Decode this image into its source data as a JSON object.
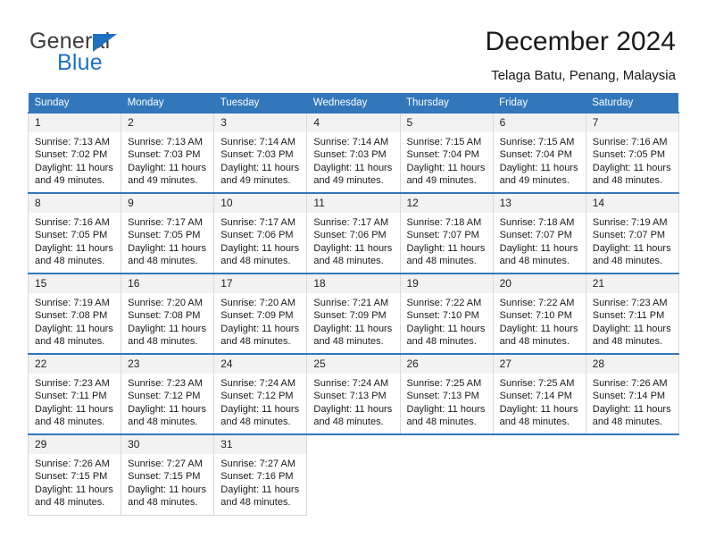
{
  "brand": {
    "name_top": "General",
    "name_bottom": "Blue",
    "accent_color": "#1f70c1"
  },
  "header": {
    "title": "December 2024",
    "subtitle": "Telaga Batu, Penang, Malaysia"
  },
  "theme": {
    "header_row_color": "#3377bb",
    "daynum_band_color": "#f2f2f2",
    "cell_border_color": "#d9d9d9"
  },
  "weekdays": [
    "Sunday",
    "Monday",
    "Tuesday",
    "Wednesday",
    "Thursday",
    "Friday",
    "Saturday"
  ],
  "labels": {
    "sunrise_prefix": "Sunrise: ",
    "sunset_prefix": "Sunset: ",
    "daylight_prefix": "Daylight: "
  },
  "weeks": [
    [
      {
        "day": "1",
        "sunrise": "Sunrise: 7:13 AM",
        "sunset": "Sunset: 7:02 PM",
        "daylight_line1": "Daylight: 11 hours",
        "daylight_line2": "and 49 minutes."
      },
      {
        "day": "2",
        "sunrise": "Sunrise: 7:13 AM",
        "sunset": "Sunset: 7:03 PM",
        "daylight_line1": "Daylight: 11 hours",
        "daylight_line2": "and 49 minutes."
      },
      {
        "day": "3",
        "sunrise": "Sunrise: 7:14 AM",
        "sunset": "Sunset: 7:03 PM",
        "daylight_line1": "Daylight: 11 hours",
        "daylight_line2": "and 49 minutes."
      },
      {
        "day": "4",
        "sunrise": "Sunrise: 7:14 AM",
        "sunset": "Sunset: 7:03 PM",
        "daylight_line1": "Daylight: 11 hours",
        "daylight_line2": "and 49 minutes."
      },
      {
        "day": "5",
        "sunrise": "Sunrise: 7:15 AM",
        "sunset": "Sunset: 7:04 PM",
        "daylight_line1": "Daylight: 11 hours",
        "daylight_line2": "and 49 minutes."
      },
      {
        "day": "6",
        "sunrise": "Sunrise: 7:15 AM",
        "sunset": "Sunset: 7:04 PM",
        "daylight_line1": "Daylight: 11 hours",
        "daylight_line2": "and 49 minutes."
      },
      {
        "day": "7",
        "sunrise": "Sunrise: 7:16 AM",
        "sunset": "Sunset: 7:05 PM",
        "daylight_line1": "Daylight: 11 hours",
        "daylight_line2": "and 48 minutes."
      }
    ],
    [
      {
        "day": "8",
        "sunrise": "Sunrise: 7:16 AM",
        "sunset": "Sunset: 7:05 PM",
        "daylight_line1": "Daylight: 11 hours",
        "daylight_line2": "and 48 minutes."
      },
      {
        "day": "9",
        "sunrise": "Sunrise: 7:17 AM",
        "sunset": "Sunset: 7:05 PM",
        "daylight_line1": "Daylight: 11 hours",
        "daylight_line2": "and 48 minutes."
      },
      {
        "day": "10",
        "sunrise": "Sunrise: 7:17 AM",
        "sunset": "Sunset: 7:06 PM",
        "daylight_line1": "Daylight: 11 hours",
        "daylight_line2": "and 48 minutes."
      },
      {
        "day": "11",
        "sunrise": "Sunrise: 7:17 AM",
        "sunset": "Sunset: 7:06 PM",
        "daylight_line1": "Daylight: 11 hours",
        "daylight_line2": "and 48 minutes."
      },
      {
        "day": "12",
        "sunrise": "Sunrise: 7:18 AM",
        "sunset": "Sunset: 7:07 PM",
        "daylight_line1": "Daylight: 11 hours",
        "daylight_line2": "and 48 minutes."
      },
      {
        "day": "13",
        "sunrise": "Sunrise: 7:18 AM",
        "sunset": "Sunset: 7:07 PM",
        "daylight_line1": "Daylight: 11 hours",
        "daylight_line2": "and 48 minutes."
      },
      {
        "day": "14",
        "sunrise": "Sunrise: 7:19 AM",
        "sunset": "Sunset: 7:07 PM",
        "daylight_line1": "Daylight: 11 hours",
        "daylight_line2": "and 48 minutes."
      }
    ],
    [
      {
        "day": "15",
        "sunrise": "Sunrise: 7:19 AM",
        "sunset": "Sunset: 7:08 PM",
        "daylight_line1": "Daylight: 11 hours",
        "daylight_line2": "and 48 minutes."
      },
      {
        "day": "16",
        "sunrise": "Sunrise: 7:20 AM",
        "sunset": "Sunset: 7:08 PM",
        "daylight_line1": "Daylight: 11 hours",
        "daylight_line2": "and 48 minutes."
      },
      {
        "day": "17",
        "sunrise": "Sunrise: 7:20 AM",
        "sunset": "Sunset: 7:09 PM",
        "daylight_line1": "Daylight: 11 hours",
        "daylight_line2": "and 48 minutes."
      },
      {
        "day": "18",
        "sunrise": "Sunrise: 7:21 AM",
        "sunset": "Sunset: 7:09 PM",
        "daylight_line1": "Daylight: 11 hours",
        "daylight_line2": "and 48 minutes."
      },
      {
        "day": "19",
        "sunrise": "Sunrise: 7:22 AM",
        "sunset": "Sunset: 7:10 PM",
        "daylight_line1": "Daylight: 11 hours",
        "daylight_line2": "and 48 minutes."
      },
      {
        "day": "20",
        "sunrise": "Sunrise: 7:22 AM",
        "sunset": "Sunset: 7:10 PM",
        "daylight_line1": "Daylight: 11 hours",
        "daylight_line2": "and 48 minutes."
      },
      {
        "day": "21",
        "sunrise": "Sunrise: 7:23 AM",
        "sunset": "Sunset: 7:11 PM",
        "daylight_line1": "Daylight: 11 hours",
        "daylight_line2": "and 48 minutes."
      }
    ],
    [
      {
        "day": "22",
        "sunrise": "Sunrise: 7:23 AM",
        "sunset": "Sunset: 7:11 PM",
        "daylight_line1": "Daylight: 11 hours",
        "daylight_line2": "and 48 minutes."
      },
      {
        "day": "23",
        "sunrise": "Sunrise: 7:23 AM",
        "sunset": "Sunset: 7:12 PM",
        "daylight_line1": "Daylight: 11 hours",
        "daylight_line2": "and 48 minutes."
      },
      {
        "day": "24",
        "sunrise": "Sunrise: 7:24 AM",
        "sunset": "Sunset: 7:12 PM",
        "daylight_line1": "Daylight: 11 hours",
        "daylight_line2": "and 48 minutes."
      },
      {
        "day": "25",
        "sunrise": "Sunrise: 7:24 AM",
        "sunset": "Sunset: 7:13 PM",
        "daylight_line1": "Daylight: 11 hours",
        "daylight_line2": "and 48 minutes."
      },
      {
        "day": "26",
        "sunrise": "Sunrise: 7:25 AM",
        "sunset": "Sunset: 7:13 PM",
        "daylight_line1": "Daylight: 11 hours",
        "daylight_line2": "and 48 minutes."
      },
      {
        "day": "27",
        "sunrise": "Sunrise: 7:25 AM",
        "sunset": "Sunset: 7:14 PM",
        "daylight_line1": "Daylight: 11 hours",
        "daylight_line2": "and 48 minutes."
      },
      {
        "day": "28",
        "sunrise": "Sunrise: 7:26 AM",
        "sunset": "Sunset: 7:14 PM",
        "daylight_line1": "Daylight: 11 hours",
        "daylight_line2": "and 48 minutes."
      }
    ],
    [
      {
        "day": "29",
        "sunrise": "Sunrise: 7:26 AM",
        "sunset": "Sunset: 7:15 PM",
        "daylight_line1": "Daylight: 11 hours",
        "daylight_line2": "and 48 minutes."
      },
      {
        "day": "30",
        "sunrise": "Sunrise: 7:27 AM",
        "sunset": "Sunset: 7:15 PM",
        "daylight_line1": "Daylight: 11 hours",
        "daylight_line2": "and 48 minutes."
      },
      {
        "day": "31",
        "sunrise": "Sunrise: 7:27 AM",
        "sunset": "Sunset: 7:16 PM",
        "daylight_line1": "Daylight: 11 hours",
        "daylight_line2": "and 48 minutes."
      },
      null,
      null,
      null,
      null
    ]
  ]
}
